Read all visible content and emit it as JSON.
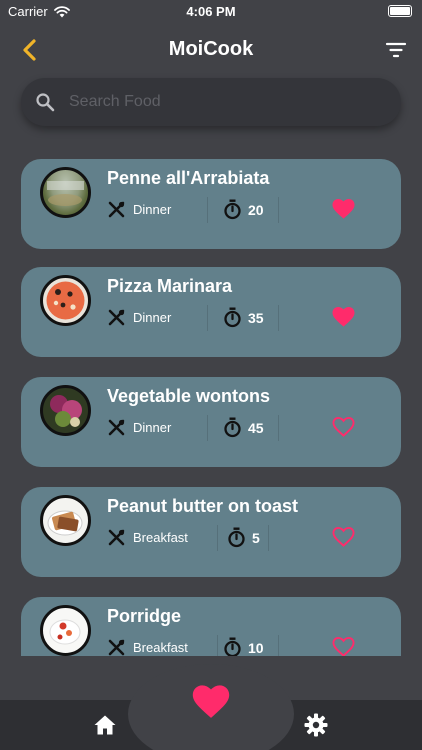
{
  "status_bar": {
    "carrier": "Carrier",
    "time": "4:06 PM"
  },
  "nav": {
    "title": "MoiCook",
    "back_icon": "chevron-left-icon",
    "filter_icon": "filter-icon"
  },
  "search": {
    "placeholder": "Search Food",
    "value": ""
  },
  "colors": {
    "accent_back": "#f0b429",
    "heart": "#ff2b6b",
    "card": "#62808b",
    "background": "#414247",
    "tab_bar": "#2e2f33"
  },
  "recipes": [
    {
      "title": "Penne all'Arrabiata",
      "meal": "Dinner",
      "time": "20",
      "favorite": true
    },
    {
      "title": "Pizza Marinara",
      "meal": "Dinner",
      "time": "35",
      "favorite": true
    },
    {
      "title": "Vegetable wontons",
      "meal": "Dinner",
      "time": "45",
      "favorite": false
    },
    {
      "title": "Peanut butter on toast",
      "meal": "Breakfast",
      "time": "5",
      "favorite": false
    },
    {
      "title": "Porridge",
      "meal": "Breakfast",
      "time": "10",
      "favorite": false
    }
  ],
  "tab_bar": {
    "home_icon": "home-icon",
    "favorites_icon": "heart-icon",
    "settings_icon": "gear-icon"
  }
}
